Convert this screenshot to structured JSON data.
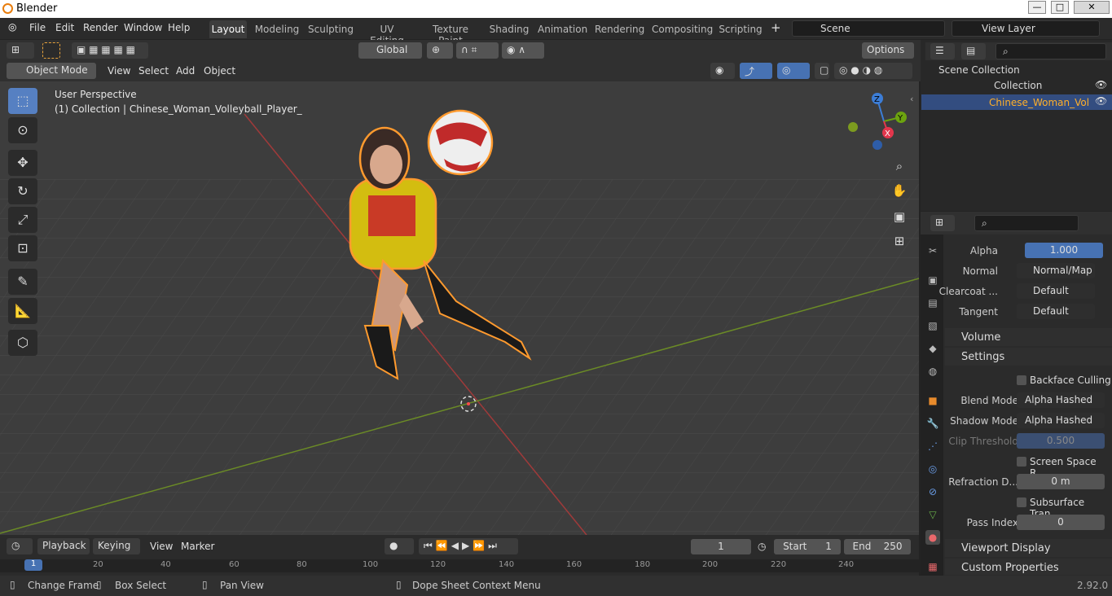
{
  "window": {
    "title": "Blender",
    "minimize": "—",
    "maximize": "□",
    "close": "✕"
  },
  "menu": {
    "items": [
      "File",
      "Edit",
      "Render",
      "Window",
      "Help"
    ]
  },
  "workspaces": [
    "Layout",
    "Modeling",
    "Sculpting",
    "UV Editing",
    "Texture Paint",
    "Shading",
    "Animation",
    "Rendering",
    "Compositing",
    "Scripting"
  ],
  "scene": "Scene",
  "view_layer": "View Layer",
  "header": {
    "orientation": "Global",
    "options": "Options",
    "mode": "Object Mode",
    "menus": [
      "View",
      "Select",
      "Add",
      "Object"
    ]
  },
  "viewport": {
    "title": "User Perspective",
    "subtitle": "(1) Collection | Chinese_Woman_Volleyball_Player_"
  },
  "gizmo": {
    "z": "Z",
    "y": "Y",
    "x": "X"
  },
  "outliner": {
    "items": [
      "Scene Collection",
      "Collection",
      "Chinese_Woman_Vol"
    ]
  },
  "properties": {
    "alpha_label": "Alpha",
    "alpha_value": "1.000",
    "normal_label": "Normal",
    "normal_value": "Normal/Map",
    "clearcoat_label": "Clearcoat ...",
    "clearcoat_value": "Default",
    "tangent_label": "Tangent",
    "tangent_value": "Default",
    "volume": "Volume",
    "settings": "Settings",
    "backface": "Backface Culling",
    "blend_label": "Blend Mode",
    "blend_value": "Alpha Hashed",
    "shadow_label": "Shadow Mode",
    "shadow_value": "Alpha Hashed",
    "clip_label": "Clip Threshold",
    "clip_value": "0.500",
    "ssr": "Screen Space R...",
    "refr_label": "Refraction D...",
    "refr_value": "0 m",
    "sst": "Subsurface Tran...",
    "pass_label": "Pass Index",
    "pass_value": "0",
    "viewport_display": "Viewport Display",
    "custom_props": "Custom Properties"
  },
  "timeline": {
    "menus": [
      "Playback",
      "Keying",
      "View",
      "Marker"
    ],
    "frame": "1",
    "start_label": "Start",
    "start": "1",
    "end_label": "End",
    "end": "250",
    "ticks": [
      "1",
      "20",
      "40",
      "60",
      "80",
      "100",
      "120",
      "140",
      "160",
      "180",
      "200",
      "220",
      "240"
    ]
  },
  "status": {
    "change_frame": "Change Frame",
    "box_select": "Box Select",
    "pan_view": "Pan View",
    "context": "Dope Sheet Context Menu",
    "version": "2.92.0"
  }
}
